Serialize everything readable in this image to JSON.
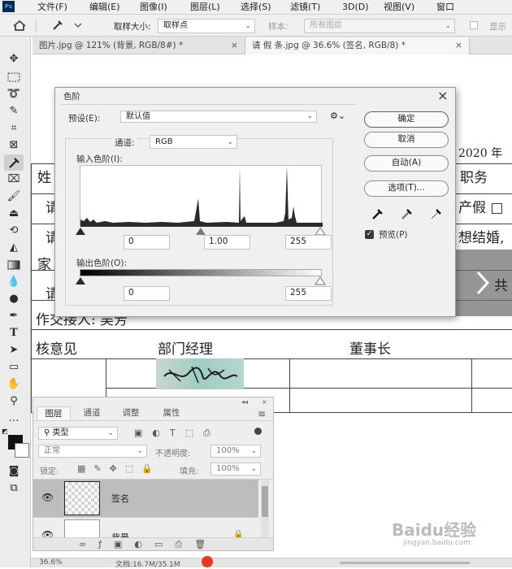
{
  "app": {
    "logo": "Ps"
  },
  "menu": [
    "文件(F)",
    "编辑(E)",
    "图像(I)",
    "图层(L)",
    "选择(S)",
    "滤镜(T)",
    "3D(D)",
    "视图(V)",
    "窗口"
  ],
  "options_bar": {
    "sample_size_label": "取样大小:",
    "sample_size_value": "取样点",
    "sample_label": "样本:",
    "sample_value": "所有图层",
    "show_ring_label": "显示"
  },
  "tabs": [
    {
      "label": "图片.jpg @ 121% (背景, RGB/8#) *",
      "active": false
    },
    {
      "label": "请 假 条.jpg @ 36.6% (签名, RGB/8) *",
      "active": true
    }
  ],
  "tools": [
    "move",
    "marquee",
    "lasso",
    "quick-select",
    "crop",
    "frame",
    "eyedropper",
    "healing",
    "brush",
    "stamp",
    "history-brush",
    "eraser",
    "gradient",
    "blur",
    "dodge",
    "pen",
    "type",
    "path-select",
    "rectangle",
    "hand",
    "zoom",
    "more",
    "swatches",
    "quick-mask",
    "screen-mode"
  ],
  "document": {
    "date_fragment": "2020 年",
    "row1_left": "姓",
    "row1_right": "职务",
    "row2_left": "请",
    "row2_right": "产假 □",
    "row3_left": "请",
    "row3_right": "想结婚,",
    "row4_left": "家",
    "row5_left": "请",
    "handover": "作交接人: 吴芳",
    "approval_label": "核意见",
    "manager_label": "部门经理",
    "chairman_label": "董事长",
    "nav_fragment": "共"
  },
  "levels_dialog": {
    "title": "色阶",
    "preset_label": "预设(E):",
    "preset_value": "默认值",
    "channel_label": "通道:",
    "channel_value": "RGB",
    "input_label": "输入色阶(I):",
    "input_black": "0",
    "input_gamma": "1.00",
    "input_white": "255",
    "output_label": "输出色阶(O):",
    "output_black": "0",
    "output_white": "255",
    "ok": "确定",
    "cancel": "取消",
    "auto": "自动(A)",
    "options": "选项(T)...",
    "preview": "预览(P)",
    "preview_checked": true
  },
  "layers_panel": {
    "tabs": [
      "图层",
      "通道",
      "调整",
      "属性"
    ],
    "filter_value": "类型",
    "blend_mode": "正常",
    "opacity_label": "不透明度:",
    "opacity_value": "100%",
    "lock_label": "锁定:",
    "fill_label": "填充:",
    "fill_value": "100%",
    "layers": [
      {
        "name": "签名",
        "selected": true
      },
      {
        "name": "背景",
        "selected": false
      }
    ]
  },
  "status": {
    "zoom": "36.6%",
    "doc": "文档:16.7M/35.1M"
  },
  "watermark": {
    "brand": "Baidu经验",
    "url": "jingyan.baidu.com"
  }
}
